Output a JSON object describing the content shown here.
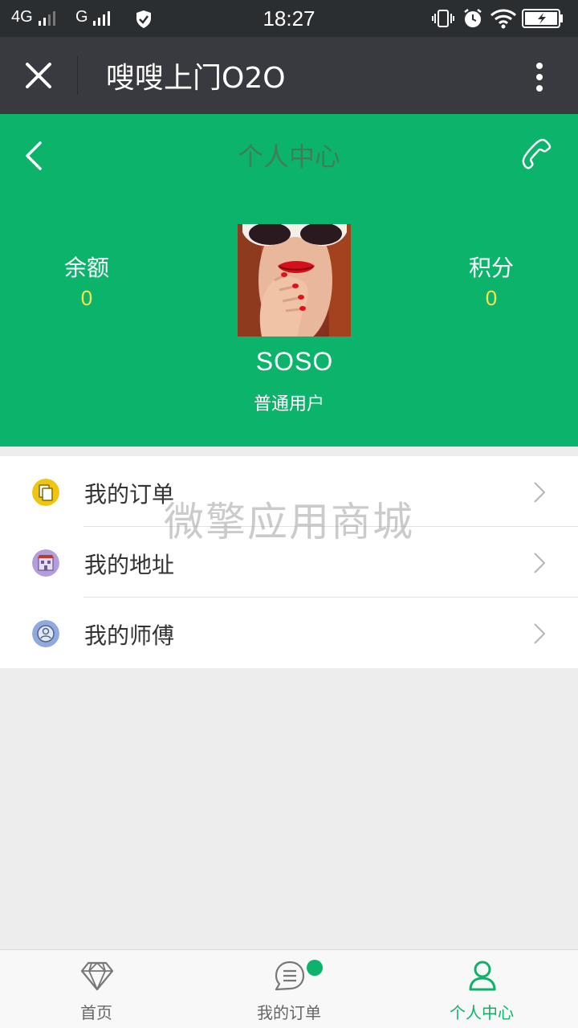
{
  "status_bar": {
    "network1": "4G",
    "network2": "G",
    "time": "18:27"
  },
  "app_bar": {
    "title": "嗖嗖上门O2O"
  },
  "header": {
    "title": "个人中心",
    "balance_label": "余额",
    "balance_value": "0",
    "points_label": "积分",
    "points_value": "0",
    "username": "SOSO",
    "user_level": "普通用户"
  },
  "menu": {
    "items": [
      {
        "label": "我的订单",
        "icon": "orders-icon",
        "color": "#f1c40f"
      },
      {
        "label": "我的地址",
        "icon": "address-icon",
        "color": "#b39ddb"
      },
      {
        "label": "我的师傅",
        "icon": "master-icon",
        "color": "#90a9e0"
      }
    ]
  },
  "watermark": "微擎应用商城",
  "tabs": [
    {
      "label": "首页",
      "icon": "diamond-icon"
    },
    {
      "label": "我的订单",
      "icon": "order-chat-icon"
    },
    {
      "label": "个人中心",
      "icon": "user-icon",
      "active": true
    }
  ],
  "colors": {
    "brand_green": "#0cb36b",
    "value_yellow": "#f5e44a",
    "wechat_bar": "#393a3f"
  }
}
